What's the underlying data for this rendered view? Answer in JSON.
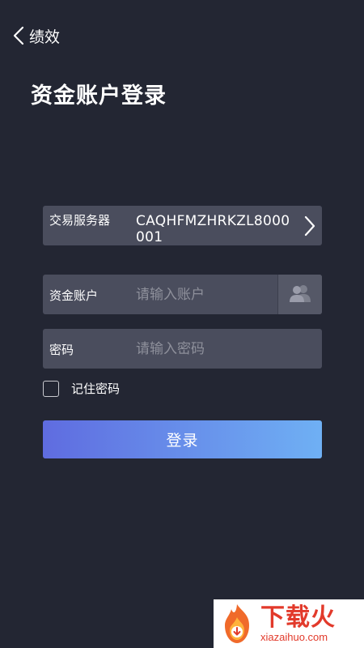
{
  "header": {
    "back_label": "绩效",
    "back_icon": "chevron-left-icon"
  },
  "page_title": "资金账户登录",
  "form": {
    "server": {
      "label": "交易服务器",
      "value": "CAQHFMZHRKZL8000001"
    },
    "account": {
      "label": "资金账户",
      "placeholder": "请输入账户",
      "icon": "users-icon"
    },
    "password": {
      "label": "密码",
      "placeholder": "请输入密码"
    },
    "remember_label": "记住密码",
    "remember_checked": false,
    "login_label": "登录"
  },
  "watermark": {
    "text_cn": "下载火",
    "text_en": "xiazaihuo.com"
  },
  "colors": {
    "background": "#232633",
    "field_bg": "#4a4d5d",
    "button_gradient_start": "#5f6ce0",
    "button_gradient_end": "#6fb0f4",
    "placeholder": "#8e909b"
  }
}
